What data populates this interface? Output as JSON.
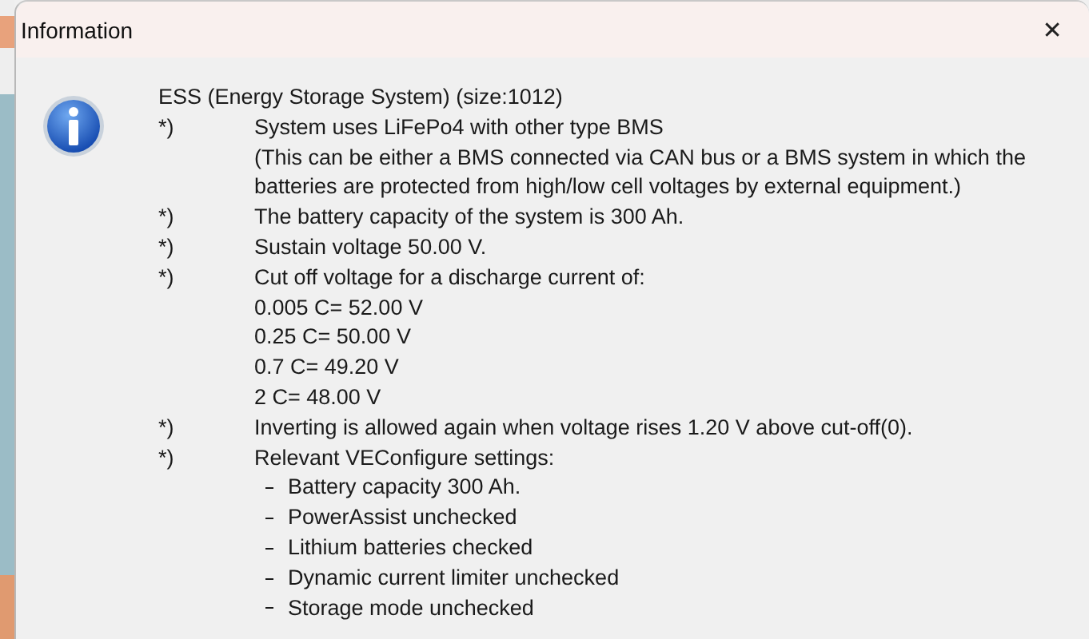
{
  "dialog": {
    "title": "Information",
    "close": "✕"
  },
  "message": {
    "heading": "ESS (Energy Storage System) (size:1012)",
    "items": [
      {
        "marker": "*)",
        "lines": [
          "System uses LiFePo4 with other type BMS",
          "(This can be either a BMS connected via CAN bus or a BMS system in which the",
          "batteries are protected from high/low cell voltages by external equipment.)"
        ]
      },
      {
        "marker": "*)",
        "lines": [
          "The battery capacity of the system is 300 Ah."
        ]
      },
      {
        "marker": "*)",
        "lines": [
          "Sustain voltage 50.00 V."
        ]
      },
      {
        "marker": "*)",
        "lines": [
          "Cut off voltage for a discharge current of:",
          "0.005 C= 52.00 V",
          "0.25 C= 50.00 V",
          "0.7 C= 49.20 V",
          "2 C= 48.00 V"
        ]
      },
      {
        "marker": "*)",
        "lines": [
          "Inverting is allowed again when voltage rises 1.20 V above cut-off(0)."
        ]
      },
      {
        "marker": "*)",
        "lines": [
          "Relevant VEConfigure settings:"
        ],
        "subitems": [
          "Battery capacity 300 Ah.",
          "PowerAssist unchecked",
          "Lithium batteries checked",
          "Dynamic current limiter unchecked",
          "Storage mode unchecked"
        ]
      }
    ]
  }
}
